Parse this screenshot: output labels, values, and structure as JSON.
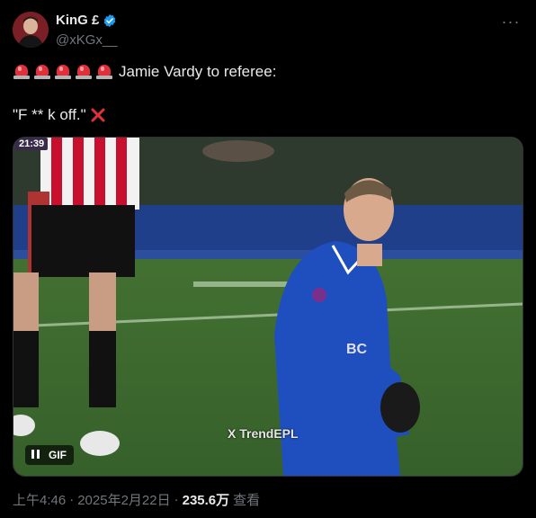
{
  "author": {
    "display_name": "KinG £",
    "handle": "@xKGx__",
    "verified": true,
    "avatar_icon": "profile-photo"
  },
  "more_icon": "more-horizontal-icon",
  "tweet": {
    "line1_text": "Jamie Vardy to referee:",
    "line1_emoji": "police-car-light x5",
    "line2_text": "\"F ** k off.\"",
    "line2_emoji": "cross-mark"
  },
  "media": {
    "timestamp": "21:39",
    "watermark": "X TrendEPL",
    "gif_label": "GIF",
    "kit_colors": {
      "leicester": "#1f4fbf",
      "opponent": "#c8102e",
      "pitch": "#3f6b2e"
    }
  },
  "meta": {
    "time": "上午4:46",
    "date": "2025年2月22日",
    "separator": "·",
    "views_count": "235.6万",
    "views_label": "查看"
  },
  "colors": {
    "background": "#000000",
    "text": "#e7e9ea",
    "muted": "#71767b",
    "verified": "#1d9bf0"
  }
}
